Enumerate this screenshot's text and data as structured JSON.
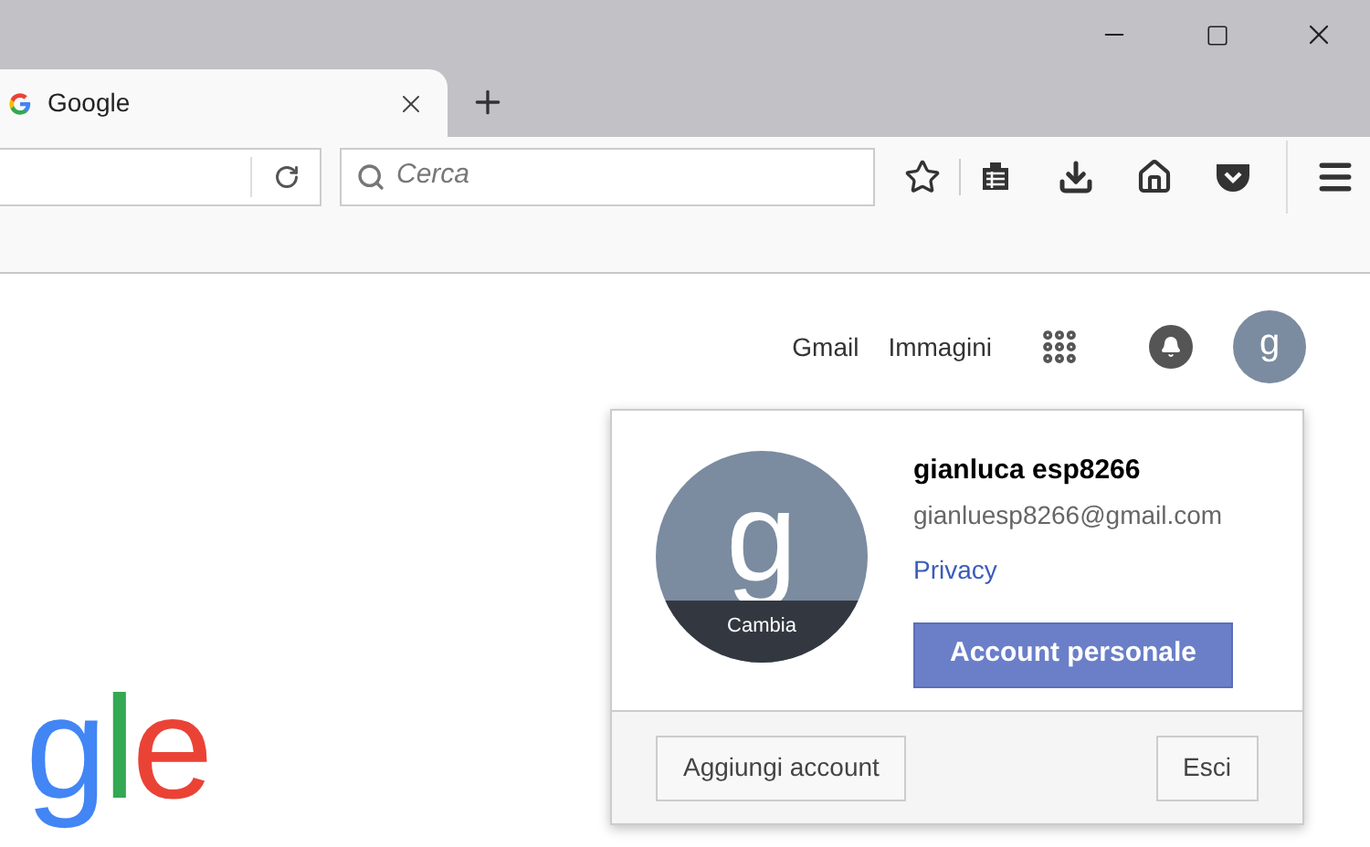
{
  "tab": {
    "title": "Google"
  },
  "search": {
    "placeholder": "Cerca"
  },
  "header_links": [
    "Gmail",
    "Immagini"
  ],
  "avatar_letter": "g",
  "account": {
    "avatar_letter": "g",
    "change_label": "Cambia",
    "name": "gianluca esp8266",
    "email": "gianluesp8266@gmail.com",
    "privacy": "Privacy",
    "primary_button": "Account personale"
  },
  "footer_buttons": [
    "Aggiungi account",
    "Esci"
  ],
  "logo": [
    {
      "char": "g",
      "color": "#4285f4"
    },
    {
      "char": "l",
      "color": "#34a853"
    },
    {
      "char": "e",
      "color": "#ea4335"
    }
  ]
}
